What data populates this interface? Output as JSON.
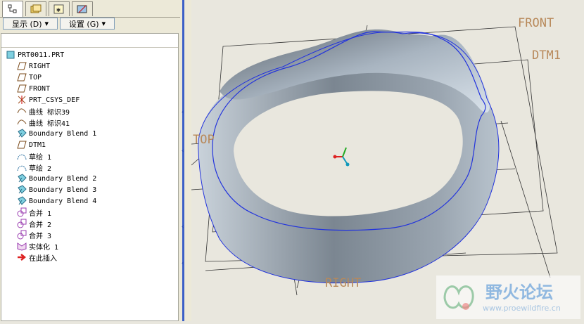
{
  "tabs": [
    {
      "name": "model-tree-tab",
      "glyph": "ꟷ"
    },
    {
      "name": "folder-browser-tab",
      "glyph": "🗂"
    },
    {
      "name": "favorites-tab",
      "glyph": "✱"
    },
    {
      "name": "connections-tab",
      "glyph": "⛁"
    }
  ],
  "toolbar": {
    "show_label": "显示 (D)",
    "settings_label": "设置 (G)"
  },
  "tree": {
    "root": "PRT0011.PRT",
    "items": [
      {
        "label": "RIGHT",
        "icon": "datum-plane-icon"
      },
      {
        "label": "TOP",
        "icon": "datum-plane-icon"
      },
      {
        "label": "FRONT",
        "icon": "datum-plane-icon"
      },
      {
        "label": "PRT_CSYS_DEF",
        "icon": "coordinate-system-icon"
      },
      {
        "label": "曲线 标识39",
        "icon": "curve-icon"
      },
      {
        "label": "曲线 标识41",
        "icon": "curve-icon"
      },
      {
        "label": "Boundary Blend 1",
        "icon": "boundary-blend-icon"
      },
      {
        "label": "DTM1",
        "icon": "datum-plane-icon"
      },
      {
        "label": "草绘 1",
        "icon": "sketch-icon"
      },
      {
        "label": "草绘 2",
        "icon": "sketch-icon"
      },
      {
        "label": "Boundary Blend 2",
        "icon": "boundary-blend-icon"
      },
      {
        "label": "Boundary Blend 3",
        "icon": "boundary-blend-icon"
      },
      {
        "label": "Boundary Blend 4",
        "icon": "boundary-blend-icon"
      },
      {
        "label": "合并 1",
        "icon": "merge-icon"
      },
      {
        "label": "合并 2",
        "icon": "merge-icon"
      },
      {
        "label": "合并 3",
        "icon": "merge-icon"
      },
      {
        "label": "实体化 1",
        "icon": "solidify-icon"
      },
      {
        "label": "在此插入",
        "icon": "insert-here-arrow-icon"
      }
    ]
  },
  "viewport": {
    "labels": {
      "front": "FRONT",
      "dtm1": "DTM1",
      "top": "TOP",
      "right": "RIGHT"
    },
    "label_color": "#b8895a",
    "watermark": {
      "title": "野火论坛",
      "url": "www.proewildfire.cn"
    }
  }
}
